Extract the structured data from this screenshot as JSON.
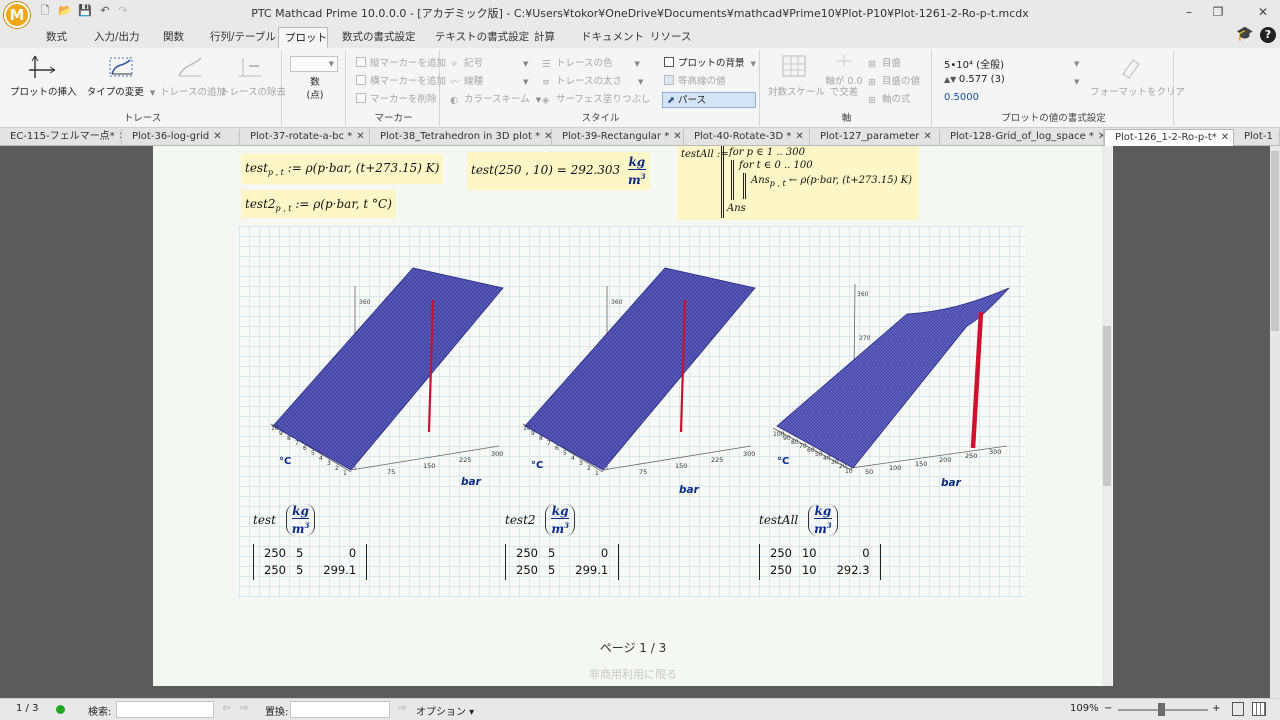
{
  "app": {
    "title": "PTC Mathcad Prime 10.0.0.0 - [アカデミック版] - C:¥Users¥tokor¥OneDrive¥Documents¥mathcad¥Prime10¥Plot-P10¥Plot-1261-2-Ro-p-t.mcdx",
    "logo_letter": "M"
  },
  "ribbon_tabs": [
    "数式",
    "入力/出力",
    "関数",
    "行列/テーブル",
    "プロット",
    "数式の書式設定",
    "テキストの書式設定",
    "計算",
    "ドキュメント",
    "リソース"
  ],
  "active_tab": "プロット",
  "ribbon": {
    "trace_group": {
      "label": "トレース",
      "insert_plot": "プロットの挿入",
      "change_type": "タイプの変更",
      "add_trace": "トレースの追加",
      "remove_trace": "トレースの除去"
    },
    "points": {
      "label": "数\n(点)"
    },
    "marker_group": {
      "label": "マーカー",
      "v_marker": "縦マーカーを追加",
      "h_marker": "横マーカーを追加",
      "del_marker": "マーカーを削除"
    },
    "style_group": {
      "label": "スタイル",
      "symbol": "記号",
      "line": "線種",
      "color_scheme": "カラースキーム",
      "trace_color": "トレースの色",
      "trace_width": "トレースの太さ",
      "surface_fill": "サーフェス塗りつぶし",
      "plot_bg": "プロットの背景",
      "contour": "等高線の値",
      "perspective": "パース"
    },
    "axis_group": {
      "label": "軸",
      "log_scale": "対数スケール",
      "axis_cross": "軸が 0.0 で交差",
      "ticks": "目盛",
      "tick_values": "目盛の値",
      "axis_expr": "軸の式"
    },
    "format_group": {
      "label": "プロットの値の書式設定",
      "val1": "5•10⁴ (全般)",
      "val2": "0.577 (3)",
      "val3": "0.5000",
      "clear": "フォーマットをクリア"
    }
  },
  "doc_tabs": [
    "EC-115-フェルマー点*",
    "Plot-36-log-grid",
    "Plot-37-rotate-a-bc *",
    "Plot-38_Tetrahedron in 3D plot *",
    "Plot-39-Rectangular *",
    "Plot-40-Rotate-3D *",
    "Plot-127_parameter",
    "Plot-128-Grid_of_log_space *",
    "Plot-126_1-2-Ro-p-t*",
    "Plot-1"
  ],
  "active_doc_tab": "Plot-126_1-2-Ro-p-t*",
  "math": {
    "test_def": "test",
    "test_sub": "p , t",
    "test_rhs": ":= ρ(p·bar, (t+273.15) K)",
    "test2_def": "test2",
    "test2_sub": "p , t",
    "test2_rhs": ":= ρ(p·bar, t °C)",
    "eval_lhs": "test(250 , 10) = 292.303",
    "eval_unit_num": "kg",
    "eval_unit_den": "m",
    "eval_unit_exp": "3",
    "prog_name": "testAll :=",
    "prog_line1": "for p ∈ 1 .. 300",
    "prog_line2": "for t ∈ 0 .. 100",
    "prog_line3": "Ans",
    "prog_line3_sub": "p , t",
    "prog_line3_rhs": "← ρ(p·bar, (t+273.15) K)",
    "prog_ret": "Ans"
  },
  "plots": [
    {
      "t_label": "°C",
      "p_label": "bar",
      "t_ticks": [
        "10",
        "9",
        "8",
        "7",
        "6",
        "5",
        "4",
        "3",
        "2",
        "1",
        "0"
      ],
      "p_ticks": [
        "75",
        "150",
        "225",
        "300"
      ],
      "z_tick": "360",
      "highlight": {
        "p": 250,
        "t": 5,
        "rho": 299.1
      }
    },
    {
      "t_label": "°C",
      "p_label": "bar",
      "t_ticks": [
        "10",
        "9",
        "8",
        "7",
        "6",
        "5",
        "4",
        "3",
        "2",
        "1",
        "0"
      ],
      "p_ticks": [
        "75",
        "150",
        "225",
        "300"
      ],
      "z_tick": "360",
      "highlight": {
        "p": 250,
        "t": 5,
        "rho": 299.1
      }
    },
    {
      "t_label": "°C",
      "p_label": "bar",
      "t_ticks": [
        "100",
        "90",
        "80",
        "70",
        "60",
        "50",
        "40",
        "30",
        "20",
        "10",
        "0"
      ],
      "p_ticks": [
        "50",
        "100",
        "150",
        "200",
        "250",
        "300"
      ],
      "z_tick": "360",
      "z_tick2": "270",
      "highlight": {
        "p": 250,
        "t": 10,
        "rho": 292.3
      }
    }
  ],
  "results": [
    {
      "name": "test",
      "unit_num": "kg",
      "unit_den": "m",
      "unit_exp": "3",
      "rows": [
        [
          "250",
          "5",
          "0"
        ],
        [
          "250",
          "5",
          "299.1"
        ]
      ]
    },
    {
      "name": "test2",
      "unit_num": "kg",
      "unit_den": "m",
      "unit_exp": "3",
      "rows": [
        [
          "250",
          "5",
          "0"
        ],
        [
          "250",
          "5",
          "299.1"
        ]
      ]
    },
    {
      "name": "testAll",
      "unit_num": "kg",
      "unit_den": "m",
      "unit_exp": "3",
      "rows": [
        [
          "250",
          "10",
          "0"
        ],
        [
          "250",
          "10",
          "292.3"
        ]
      ]
    }
  ],
  "page": {
    "page_number": "ページ 1 / 3",
    "noncommercial": "非商用利用に限る"
  },
  "status": {
    "page": "1 / 3",
    "search_label": "検索:",
    "replace_label": "置換:",
    "options": "オプション",
    "zoom": "109%"
  },
  "colors": {
    "surface": "#3e3f9e",
    "highlight": "#c4142f",
    "math_bg": "#fdf6c6",
    "accent": "#0b2a8a"
  }
}
